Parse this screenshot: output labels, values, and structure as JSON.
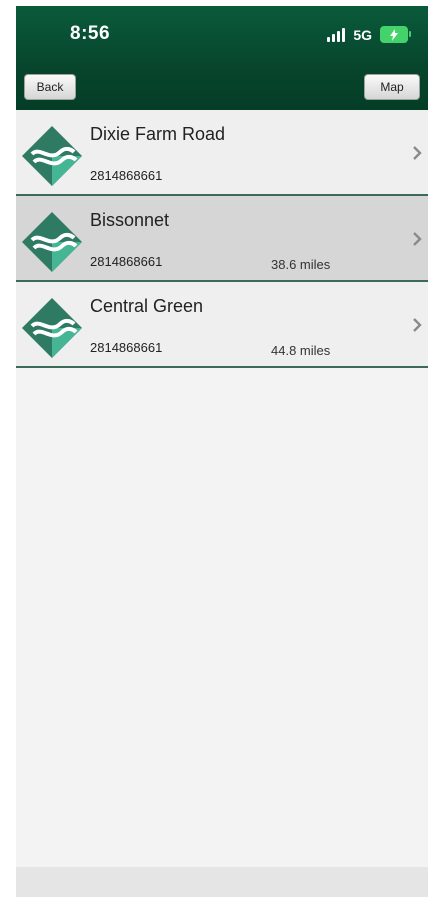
{
  "status_bar": {
    "time": "8:56",
    "network": "5G"
  },
  "nav": {
    "back_label": "Back",
    "map_label": "Map"
  },
  "locations": [
    {
      "name": "Dixie Farm Road",
      "phone": "2814868661",
      "distance": ""
    },
    {
      "name": "Bissonnet",
      "phone": "2814868661",
      "distance": "38.6 miles"
    },
    {
      "name": "Central Green",
      "phone": "2814868661",
      "distance": "44.8 miles"
    }
  ],
  "colors": {
    "header_green": "#07452c",
    "logo_dark": "#2e7a62",
    "logo_light": "#45b594",
    "selected_row": "#d6d6d6"
  }
}
